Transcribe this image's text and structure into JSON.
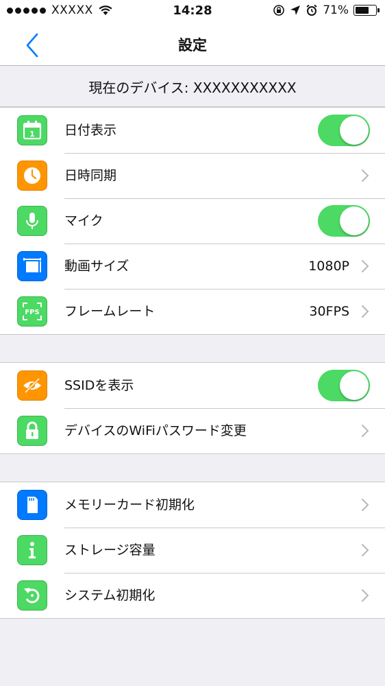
{
  "status_bar": {
    "carrier": "XXXXX",
    "time": "14:28",
    "battery": "71%",
    "battery_level": 0.71
  },
  "nav": {
    "title": "設定",
    "back_icon": "chevron-left-icon"
  },
  "device_header": {
    "text": "現在のデバイス: XXXXXXXXXXX"
  },
  "groups": [
    {
      "rows": [
        {
          "label": "日付表示",
          "icon": "calendar-icon",
          "icon_color": "#4cd964",
          "control": "toggle",
          "on": true
        },
        {
          "label": "日時同期",
          "icon": "clock-icon",
          "icon_color": "#ff9500",
          "control": "chevron"
        },
        {
          "label": "マイク",
          "icon": "microphone-icon",
          "icon_color": "#4cd964",
          "control": "toggle",
          "on": true
        },
        {
          "label": "動画サイズ",
          "value": "1080P",
          "icon": "video-size-icon",
          "icon_color": "#007aff",
          "control": "chevron"
        },
        {
          "label": "フレームレート",
          "value": "30FPS",
          "icon": "fps-icon",
          "icon_color": "#4cd964",
          "control": "chevron"
        }
      ]
    },
    {
      "rows": [
        {
          "label": "SSIDを表示",
          "icon": "eye-slash-icon",
          "icon_color": "#ff9500",
          "control": "toggle",
          "on": true
        },
        {
          "label": "デバイスのWiFiパスワード変更",
          "icon": "lock-icon",
          "icon_color": "#4cd964",
          "control": "chevron"
        }
      ]
    },
    {
      "rows": [
        {
          "label": "メモリーカード初期化",
          "icon": "sd-card-icon",
          "icon_color": "#007aff",
          "control": "chevron"
        },
        {
          "label": "ストレージ容量",
          "icon": "info-icon",
          "icon_color": "#4cd964",
          "control": "chevron"
        },
        {
          "label": "システム初期化",
          "icon": "reset-icon",
          "icon_color": "#4cd964",
          "control": "chevron"
        }
      ]
    }
  ],
  "colors": {
    "accent": "#007aff",
    "toggle_on": "#4cd964",
    "background": "#efeff4"
  }
}
